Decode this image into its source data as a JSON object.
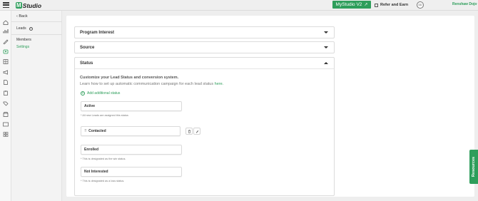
{
  "header": {
    "logo_mark": "M",
    "logo_text": "Studio",
    "studio_button": "MyStudio V2",
    "refer": "Refer and Earn",
    "avatar": "DD",
    "user_name": "Renshaw Dojo"
  },
  "sidebar": {
    "back": "Back",
    "section": "Leads",
    "links": [
      {
        "label": "Members"
      },
      {
        "label": "Settings"
      }
    ]
  },
  "accordions": {
    "program_interest": "Program Interest",
    "source": "Source",
    "status": "Status"
  },
  "status": {
    "title": "Customize your Lead Status and conversion system.",
    "learn_prefix": "Learn how to set up automatic communication campaign for each lead status ",
    "learn_link": "here.",
    "add_label": "Add additional status",
    "items": [
      {
        "label": "Active",
        "note": "* All new Leads are assigned this status"
      },
      {
        "label": "Contacted",
        "note": ""
      },
      {
        "label": "Enrolled",
        "note": "* This is designated as the win status."
      },
      {
        "label": "Not Interested",
        "note": "* This is designated as a loss status."
      }
    ]
  },
  "resources_tab": "Resources",
  "colors": {
    "accent": "#2e9e5b",
    "background": "#eeeeee",
    "card": "#ffffff"
  }
}
